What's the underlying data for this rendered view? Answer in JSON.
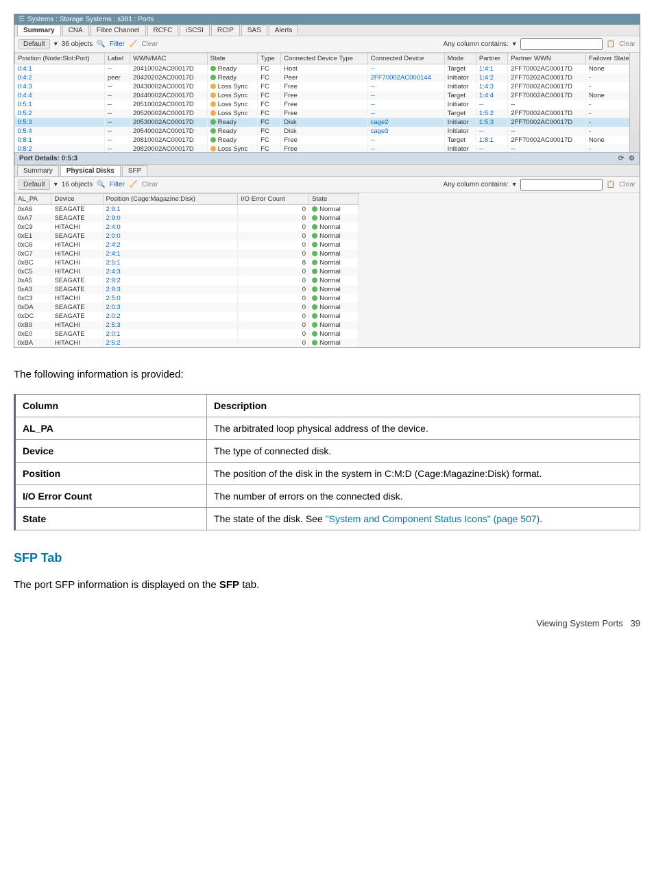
{
  "breadcrumb": "Systems : Storage Systems : s381 : Ports",
  "upper_tabs": [
    "Summary",
    "CNA",
    "Fibre Channel",
    "RCFC",
    "iSCSI",
    "RCIP",
    "SAS",
    "Alerts"
  ],
  "upper_active_tab": 0,
  "toolbar": {
    "default_btn": "Default",
    "objects": "36 objects",
    "filter": "Filter",
    "clear": "Clear",
    "any_col": "Any column contains:",
    "clear_right": "Clear"
  },
  "upper_headers": [
    "Position (Node:Slot:Port)",
    "Label",
    "WWN/MAC",
    "State",
    "Type",
    "Connected Device Type",
    "Connected Device",
    "Mode",
    "Partner",
    "Partner WWN",
    "Failover State"
  ],
  "upper_rows": [
    {
      "pos": "0:4:1",
      "label": "--",
      "wwn": "20410002AC00017D",
      "state": "Ready",
      "dot": "green",
      "type": "FC",
      "cdt": "Host",
      "cd": "--",
      "mode": "Target",
      "partner": "1:4:1",
      "pwwn": "2FF70002AC00017D",
      "fail": "None"
    },
    {
      "pos": "0:4:2",
      "label": "peer",
      "wwn": "20420202AC00017D",
      "state": "Ready",
      "dot": "green",
      "type": "FC",
      "cdt": "Peer",
      "cd": "2FF70002AC000144",
      "mode": "Initiator",
      "partner": "1:4:2",
      "pwwn": "2FF70202AC00017D",
      "fail": "-"
    },
    {
      "pos": "0:4:3",
      "label": "--",
      "wwn": "20430002AC00017D",
      "state": "Loss Sync",
      "dot": "yellow",
      "type": "FC",
      "cdt": "Free",
      "cd": "--",
      "mode": "Initiator",
      "partner": "1:4:3",
      "pwwn": "2FF70002AC00017D",
      "fail": "-"
    },
    {
      "pos": "0:4:4",
      "label": "--",
      "wwn": "20440002AC00017D",
      "state": "Loss Sync",
      "dot": "yellow",
      "type": "FC",
      "cdt": "Free",
      "cd": "--",
      "mode": "Target",
      "partner": "1:4:4",
      "pwwn": "2FF70002AC00017D",
      "fail": "None"
    },
    {
      "pos": "0:5:1",
      "label": "--",
      "wwn": "20510002AC00017D",
      "state": "Loss Sync",
      "dot": "yellow",
      "type": "FC",
      "cdt": "Free",
      "cd": "--",
      "mode": "Initiator",
      "partner": "--",
      "pwwn": "--",
      "fail": "-"
    },
    {
      "pos": "0:5:2",
      "label": "--",
      "wwn": "20520002AC00017D",
      "state": "Loss Sync",
      "dot": "yellow",
      "type": "FC",
      "cdt": "Free",
      "cd": "--",
      "mode": "Target",
      "partner": "1:5:2",
      "pwwn": "2FF70002AC00017D",
      "fail": "-"
    },
    {
      "pos": "0:5:3",
      "label": "--",
      "wwn": "20530002AC00017D",
      "state": "Ready",
      "dot": "green",
      "type": "FC",
      "cdt": "Disk",
      "cd": "cage2",
      "mode": "Initiator",
      "partner": "1:5:3",
      "pwwn": "2FF70002AC00017D",
      "fail": "-",
      "hl": true
    },
    {
      "pos": "0:5:4",
      "label": "--",
      "wwn": "20540002AC00017D",
      "state": "Ready",
      "dot": "green",
      "type": "FC",
      "cdt": "Disk",
      "cd": "cage3",
      "mode": "Initiator",
      "partner": "--",
      "pwwn": "--",
      "fail": "-"
    },
    {
      "pos": "0:8:1",
      "label": "--",
      "wwn": "20810002AC00017D",
      "state": "Ready",
      "dot": "green",
      "type": "FC",
      "cdt": "Free",
      "cd": "--",
      "mode": "Target",
      "partner": "1:8:1",
      "pwwn": "2FF70002AC00017D",
      "fail": "None"
    },
    {
      "pos": "0:8:2",
      "label": "--",
      "wwn": "20820002AC00017D",
      "state": "Loss Sync",
      "dot": "yellow",
      "type": "FC",
      "cdt": "Free",
      "cd": "--",
      "mode": "Initiator",
      "partner": "--",
      "pwwn": "--",
      "fail": "-"
    }
  ],
  "port_details_header": "Port Details: 0:5:3",
  "lower_tabs": [
    "Summary",
    "Physical Disks",
    "SFP"
  ],
  "lower_active_tab": 1,
  "lower_toolbar": {
    "default_btn": "Default",
    "objects": "16 objects",
    "filter": "Filter",
    "clear": "Clear",
    "any_col": "Any column contains:",
    "clear_right": "Clear"
  },
  "lower_headers": [
    "AL_PA",
    "Device",
    "Position (Cage:Magazine:Disk)",
    "I/O Error Count",
    "State"
  ],
  "lower_rows": [
    {
      "al": "0xA6",
      "dev": "SEAGATE",
      "pos": "2:9:1",
      "io": "0",
      "state": "Normal"
    },
    {
      "al": "0xA7",
      "dev": "SEAGATE",
      "pos": "2:9:0",
      "io": "0",
      "state": "Normal"
    },
    {
      "al": "0xC9",
      "dev": "HITACHI",
      "pos": "2:4:0",
      "io": "0",
      "state": "Normal"
    },
    {
      "al": "0xE1",
      "dev": "SEAGATE",
      "pos": "2:0:0",
      "io": "0",
      "state": "Normal"
    },
    {
      "al": "0xC6",
      "dev": "HITACHI",
      "pos": "2:4:2",
      "io": "0",
      "state": "Normal"
    },
    {
      "al": "0xC7",
      "dev": "HITACHI",
      "pos": "2:4:1",
      "io": "0",
      "state": "Normal"
    },
    {
      "al": "0xBC",
      "dev": "HITACHI",
      "pos": "2:5:1",
      "io": "8",
      "state": "Normal"
    },
    {
      "al": "0xC5",
      "dev": "HITACHI",
      "pos": "2:4:3",
      "io": "0",
      "state": "Normal"
    },
    {
      "al": "0xA5",
      "dev": "SEAGATE",
      "pos": "2:9:2",
      "io": "0",
      "state": "Normal"
    },
    {
      "al": "0xA3",
      "dev": "SEAGATE",
      "pos": "2:9:3",
      "io": "0",
      "state": "Normal"
    },
    {
      "al": "0xC3",
      "dev": "HITACHI",
      "pos": "2:5:0",
      "io": "0",
      "state": "Normal"
    },
    {
      "al": "0xDA",
      "dev": "SEAGATE",
      "pos": "2:0:3",
      "io": "0",
      "state": "Normal"
    },
    {
      "al": "0xDC",
      "dev": "SEAGATE",
      "pos": "2:0:2",
      "io": "0",
      "state": "Normal"
    },
    {
      "al": "0xB9",
      "dev": "HITACHI",
      "pos": "2:5:3",
      "io": "0",
      "state": "Normal"
    },
    {
      "al": "0xE0",
      "dev": "SEAGATE",
      "pos": "2:0:1",
      "io": "0",
      "state": "Normal"
    },
    {
      "al": "0xBA",
      "dev": "HITACHI",
      "pos": "2:5:2",
      "io": "0",
      "state": "Normal"
    }
  ],
  "provided_text": "The following information is provided:",
  "desc_headers": {
    "col": "Column",
    "desc": "Description"
  },
  "desc_rows": [
    {
      "col": "AL_PA",
      "desc": "The arbitrated loop physical address of the device."
    },
    {
      "col": "Device",
      "desc": "The type of connected disk."
    },
    {
      "col": "Position",
      "desc": "The position of the disk in the system in C:M:D (Cage:Magazine:Disk) format."
    },
    {
      "col": "I/O Error Count",
      "desc": "The number of errors on the connected disk."
    },
    {
      "col": "State",
      "desc_prefix": "The state of the disk. See ",
      "link": "\"System and Component Status Icons\" (page 507)",
      "desc_suffix": "."
    }
  ],
  "sfp_title": "SFP Tab",
  "sfp_text_before": "The port SFP information is displayed on the ",
  "sfp_text_bold": "SFP",
  "sfp_text_after": " tab.",
  "footer": {
    "label": "Viewing System Ports",
    "page": "39"
  }
}
